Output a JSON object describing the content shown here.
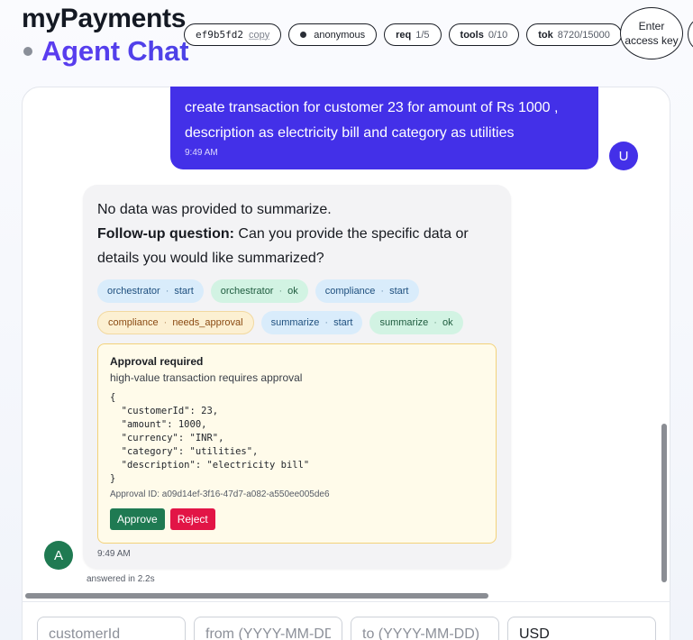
{
  "header": {
    "brand": "myPayments",
    "subtitle": "Agent Chat",
    "session_id": "ef9b5fd2",
    "copy_label": "copy",
    "user_label": "anonymous",
    "req_key": "req",
    "req_value": "1/5",
    "tools_key": "tools",
    "tools_value": "0/10",
    "tok_key": "tok",
    "tok_value": "8720/15000",
    "access_key_label": "Enter access key"
  },
  "chat": {
    "user_message": {
      "text": "create transaction for customer 23 for amount of Rs 1000 , description as electricity bill and category as utilities",
      "time": "9:49 AM",
      "avatar": "U"
    },
    "agent_message": {
      "line1": "No data was provided to summarize.",
      "followup_label": "Follow-up question:",
      "followup_text": "Can you provide the specific data or details you would like summarized?",
      "events": [
        {
          "agent": "orchestrator",
          "status": "start"
        },
        {
          "agent": "orchestrator",
          "status": "ok"
        },
        {
          "agent": "compliance",
          "status": "start"
        },
        {
          "agent": "compliance",
          "status": "needs_approval"
        },
        {
          "agent": "summarize",
          "status": "start"
        },
        {
          "agent": "summarize",
          "status": "ok"
        }
      ],
      "approval": {
        "title": "Approval required",
        "reason": "high-value transaction requires approval",
        "payload": "{\n  \"customerId\": 23,\n  \"amount\": 1000,\n  \"currency\": \"INR\",\n  \"category\": \"utilities\",\n  \"description\": \"electricity bill\"\n}",
        "id_text": "Approval ID: a09d14ef-3f16-47d7-a082-a550ee005de6",
        "approve_label": "Approve",
        "reject_label": "Reject"
      },
      "time": "9:49 AM",
      "avatar": "A",
      "answered": "answered in 2.2s"
    }
  },
  "composer": {
    "customer_placeholder": "customerId",
    "from_placeholder": "from (YYYY-MM-DD)",
    "to_placeholder": "to (YYYY-MM-DD)",
    "currency_value": "USD"
  },
  "colors": {
    "accent": "#4330e8",
    "agent_avatar": "#1f7a52",
    "approve": "#1f7a52",
    "reject": "#e21546"
  }
}
